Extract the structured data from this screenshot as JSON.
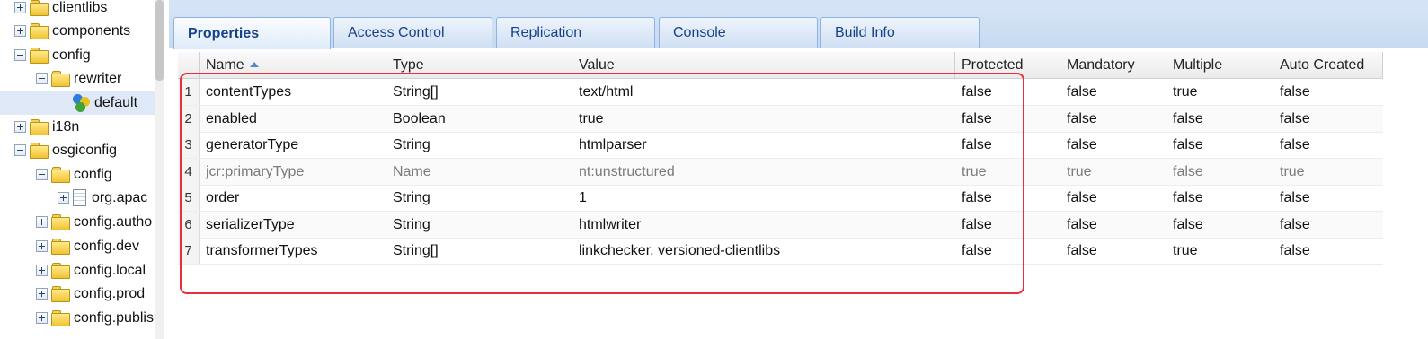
{
  "tree": {
    "nodes": [
      {
        "label": "clientlibs",
        "toggle": "plus",
        "icon": "folder-icon"
      },
      {
        "label": "components",
        "toggle": "plus",
        "icon": "folder-icon"
      },
      {
        "label": "config",
        "toggle": "minus",
        "icon": "folder-icon"
      },
      {
        "label": "rewriter",
        "toggle": "minus",
        "icon": "folder-icon"
      },
      {
        "label": "default",
        "toggle": "none",
        "icon": "node-icon",
        "selected": true
      },
      {
        "label": "i18n",
        "toggle": "plus",
        "icon": "folder-icon"
      },
      {
        "label": "osgiconfig",
        "toggle": "minus",
        "icon": "folder-icon"
      },
      {
        "label": "config",
        "toggle": "minus",
        "icon": "folder-icon"
      },
      {
        "label": "org.apac",
        "toggle": "plus",
        "icon": "file-icon"
      },
      {
        "label": "config.autho",
        "toggle": "plus",
        "icon": "folder-icon"
      },
      {
        "label": "config.dev",
        "toggle": "plus",
        "icon": "folder-icon"
      },
      {
        "label": "config.local",
        "toggle": "plus",
        "icon": "folder-icon"
      },
      {
        "label": "config.prod",
        "toggle": "plus",
        "icon": "folder-icon"
      },
      {
        "label": "config.publis",
        "toggle": "plus",
        "icon": "folder-icon"
      }
    ]
  },
  "tabs": [
    {
      "label": "Properties",
      "active": true
    },
    {
      "label": "Access Control"
    },
    {
      "label": "Replication"
    },
    {
      "label": "Console"
    },
    {
      "label": "Build Info"
    }
  ],
  "grid": {
    "columns": [
      "Name",
      "Type",
      "Value",
      "Protected",
      "Mandatory",
      "Multiple",
      "Auto Created"
    ],
    "sort_column": "Name",
    "sort_direction": "ascending",
    "rows": [
      {
        "num": "1",
        "name": "contentTypes",
        "type": "String[]",
        "value": "text/html",
        "protected": "false",
        "mandatory": "false",
        "multiple": "true",
        "auto_created": "false"
      },
      {
        "num": "2",
        "name": "enabled",
        "type": "Boolean",
        "value": "true",
        "protected": "false",
        "mandatory": "false",
        "multiple": "false",
        "auto_created": "false"
      },
      {
        "num": "3",
        "name": "generatorType",
        "type": "String",
        "value": "htmlparser",
        "protected": "false",
        "mandatory": "false",
        "multiple": "false",
        "auto_created": "false"
      },
      {
        "num": "4",
        "name": "jcr:primaryType",
        "type": "Name",
        "value": "nt:unstructured",
        "protected": "true",
        "mandatory": "true",
        "multiple": "false",
        "auto_created": "true",
        "dimmed": true
      },
      {
        "num": "5",
        "name": "order",
        "type": "String",
        "value": "1",
        "protected": "false",
        "mandatory": "false",
        "multiple": "false",
        "auto_created": "false"
      },
      {
        "num": "6",
        "name": "serializerType",
        "type": "String",
        "value": "htmlwriter",
        "protected": "false",
        "mandatory": "false",
        "multiple": "false",
        "auto_created": "false"
      },
      {
        "num": "7",
        "name": "transformerTypes",
        "type": "String[]",
        "value": "linkchecker, versioned-clientlibs",
        "protected": "false",
        "mandatory": "false",
        "multiple": "true",
        "auto_created": "false"
      }
    ]
  },
  "colors": {
    "highlight": "#e8303a",
    "tab_text": "#15428b",
    "selected_node": "#dfe8f6"
  }
}
